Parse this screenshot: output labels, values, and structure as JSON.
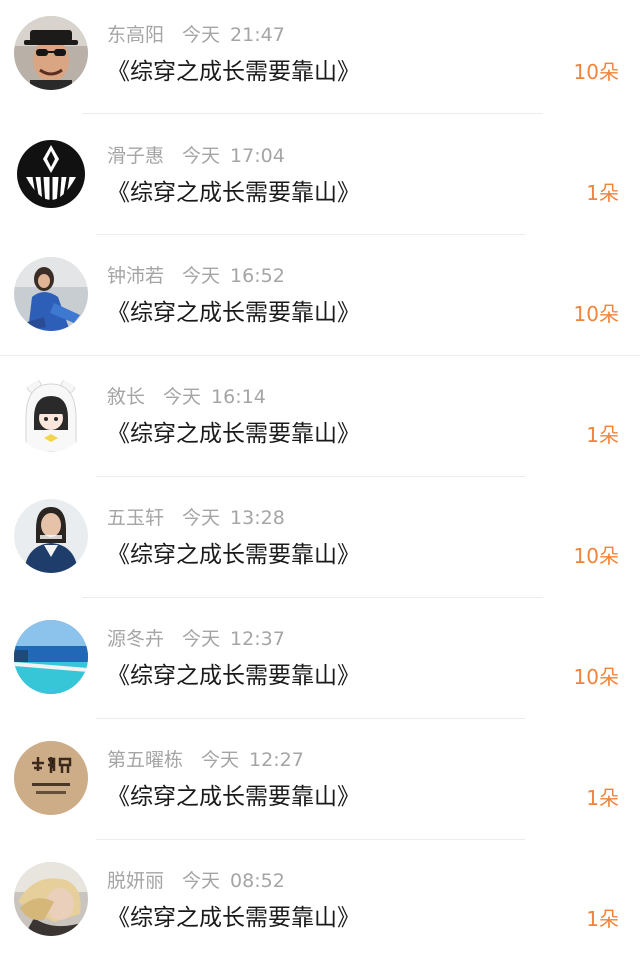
{
  "entries": [
    {
      "name": "东高阳",
      "date": "今天",
      "time": "21:47",
      "title": "《综穿之成长需要靠山》",
      "gift": "10朵",
      "avatar": "man-sunglasses-hat-avatar"
    },
    {
      "name": "滑子惠",
      "date": "今天",
      "time": "17:04",
      "title": "《综穿之成长需要靠山》",
      "gift": "1朵",
      "avatar": "black-logo-avatar"
    },
    {
      "name": "钟沛若",
      "date": "今天",
      "time": "16:52",
      "title": "《综穿之成长需要靠山》",
      "gift": "10朵",
      "avatar": "girl-blue-jacket-avatar"
    },
    {
      "name": "敘长",
      "date": "今天",
      "time": "16:14",
      "title": "《综穿之成长需要靠山》",
      "gift": "1朵",
      "avatar": "cartoon-girl-bear-hood-avatar"
    },
    {
      "name": "五玉轩",
      "date": "今天",
      "time": "13:28",
      "title": "《综穿之成长需要靠山》",
      "gift": "10朵",
      "avatar": "girl-portrait-avatar"
    },
    {
      "name": "源冬卉",
      "date": "今天",
      "time": "12:37",
      "title": "《综穿之成长需要靠山》",
      "gift": "10朵",
      "avatar": "infinity-pool-sea-avatar"
    },
    {
      "name": "第五曜栋",
      "date": "今天",
      "time": "12:27",
      "title": "《综穿之成长需要靠山》",
      "gift": "1朵",
      "avatar": "graduation-sign-avatar"
    },
    {
      "name": "脱妍丽",
      "date": "今天",
      "time": "08:52",
      "title": "《综穿之成长需要靠山》",
      "gift": "1朵",
      "avatar": "blonde-woman-avatar"
    }
  ],
  "colors": {
    "name_meta": "#a5a5a5",
    "title": "#1a1a1a",
    "gift_accent": "#f0843c",
    "divider": "#ececec"
  }
}
